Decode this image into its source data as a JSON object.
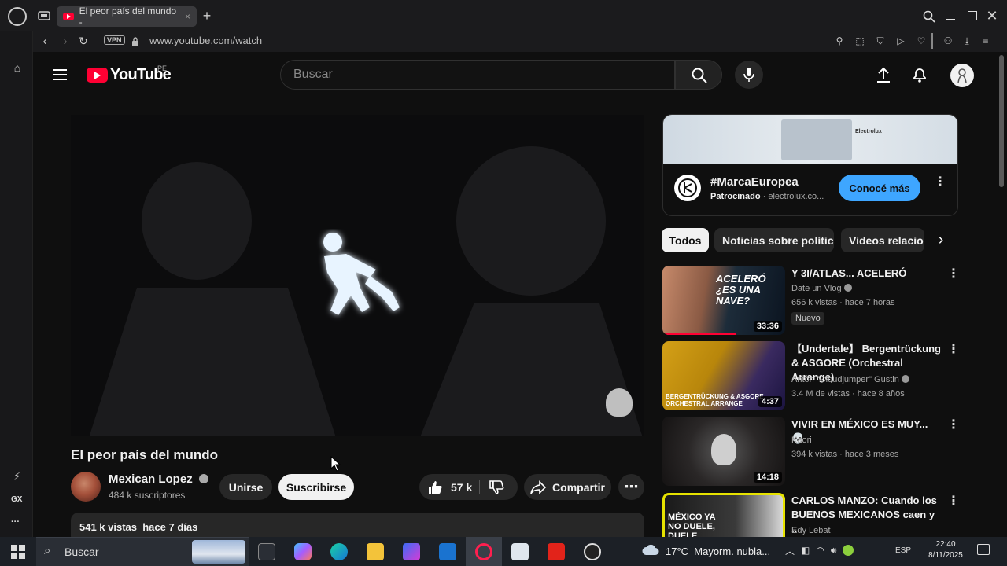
{
  "browser": {
    "tab_title": "El peor país del mundo -",
    "new_tab": "+",
    "vpn_label": "VPN",
    "url": "www.youtube.com/watch",
    "sidebar_gx": "GX",
    "sidebar_more": "···"
  },
  "header": {
    "logo_text": "YouTube",
    "country_code": "PE",
    "search_placeholder": "Buscar"
  },
  "video": {
    "title": "El peor país del mundo",
    "channel_name": "Mexican Lopez",
    "subscribers": "484 k suscriptores",
    "join_label": "Unirse",
    "subscribe_label": "Suscribirse",
    "likes": "57 k",
    "share_label": "Compartir",
    "views_date": "541 k vistas  hace 7 días"
  },
  "ad": {
    "title": "#MarcaEuropea",
    "sponsored_label": "Patrocinado",
    "domain": "· electrolux.co...",
    "cta_label": "Conocé más",
    "banner_brand": "Electrolux"
  },
  "chips": [
    "Todos",
    "Noticias sobre política",
    "Videos relacio"
  ],
  "recommended": [
    {
      "title": "Y 3I/ATLAS... ACELERÓ",
      "channel": "Date un Vlog",
      "meta": "656 k vistas · hace 7 horas",
      "badge": "Nuevo",
      "duration": "33:36",
      "thumb_text": "ACELERÓ ¿ES UNA NAVE?"
    },
    {
      "title": "【Undertale】 Bergentrückung & ASGORE (Orchestral Arrange)",
      "channel": "Anton \"Cloudjumper\" Gustin",
      "meta": "3.4 M de vistas · hace 8 años",
      "duration": "4:37",
      "thumb_text": "BERGENTRÜCKUNG & ASGORE ORCHESTRAL ARRANGE"
    },
    {
      "title": "VIVIR EN MÉXICO ES MUY... 💀",
      "channel": "Kaori",
      "meta": "394 k vistas · hace 3 meses",
      "duration": "14:18"
    },
    {
      "title": "CARLOS MANZO: Cuando los BUENOS MEXICANOS caen y ...",
      "channel": "Edy Lebat",
      "thumb_text": "MÉXICO YA NO DUELE, DUELE"
    }
  ],
  "taskbar": {
    "search_placeholder": "Buscar",
    "weather": "17°C  Mayorm. nubla...",
    "language": "ESP",
    "time": "22:40",
    "date": "8/11/2025"
  }
}
